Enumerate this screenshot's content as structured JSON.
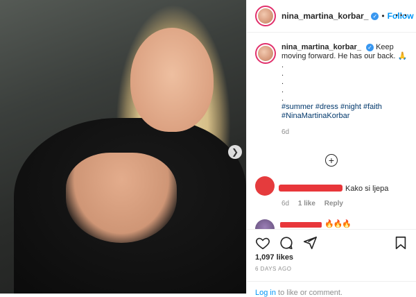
{
  "post": {
    "username": "nina_martina_korbar_",
    "verified_mark": "✓",
    "separator": "•",
    "follow_label": "Follow",
    "more_label": "···"
  },
  "caption": {
    "username": "nina_martina_korbar_",
    "text": "Keep moving forward. He has our back. 🙏",
    "dots": [
      ".",
      ".",
      ".",
      ".",
      "."
    ],
    "hashtags_line1": "#summer #dress #night #faith",
    "hashtags_line2": "#NinaMartinaKorbar",
    "age": "6d"
  },
  "load_more_label": "+",
  "comments": [
    {
      "text": "Kako si ljepa",
      "age": "6d",
      "likes": "1 like",
      "reply_label": "Reply"
    },
    {
      "emoji": "🔥🔥🔥"
    }
  ],
  "icons": {
    "like": "heart-icon",
    "comment": "comment-icon",
    "share": "share-icon",
    "save": "bookmark-icon",
    "next": "chevron-right-icon",
    "more": "more-icon",
    "load_more": "plus-circle-icon"
  },
  "stats": {
    "likes": "1,097 likes",
    "date": "6 DAYS AGO"
  },
  "footer": {
    "login_link": "Log in",
    "login_rest": " to like or comment."
  },
  "colors": {
    "accent": "#0095f6",
    "verified": "#3897f0",
    "redaction": "#e8363a"
  }
}
